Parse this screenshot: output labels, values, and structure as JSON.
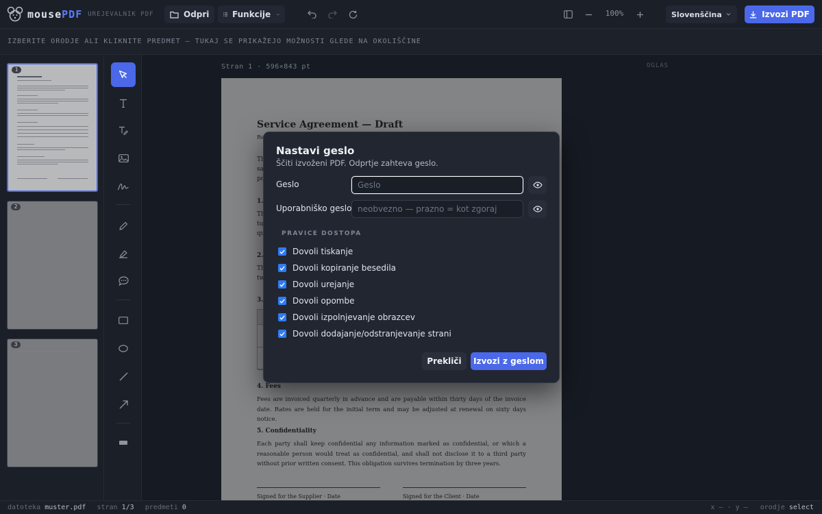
{
  "app": {
    "name_main": "mouse",
    "name_accent": "PDF",
    "subtitle": "UREJEVALNIK PDF"
  },
  "toolbar": {
    "open_label": "Odpri",
    "functions_label": "Funkcije",
    "zoom": "100%",
    "language": "Slovenščina",
    "export_label": "Izvozi PDF"
  },
  "context_hint": "IZBERITE ORODJE ALI KLIKNITE PREDMET — TUKAJ SE PRIKAŽEJO MOŽNOSTI GLEDE NA OKOLIŠČINE",
  "thumbnails": [
    {
      "num": "1"
    },
    {
      "num": "2"
    },
    {
      "num": "3"
    }
  ],
  "workspace": {
    "page_label": "Stran 1 · 596×843 pt",
    "ad_label": "OGLAS"
  },
  "document": {
    "title": "Service Agreement — Draft",
    "frag_ref": "Re",
    "frag_intro": [
      "Th",
      "sa",
      "po"
    ],
    "frag_h1": "1.",
    "frag_p1": [
      "Th",
      "tu",
      "qu"
    ],
    "frag_h2": "2.",
    "frag_p2": [
      "Th",
      "tw"
    ],
    "frag_h3": "3.",
    "h4": "4. Fees",
    "p4": "Fees are invoiced quarterly in advance and are payable within thirty days of the invoice date. Rates are held for the initial term and may be adjusted at renewal on sixty days notice.",
    "h5": "5. Confidentiality",
    "p5": "Each party shall keep confidential any information marked as confidential, or which a reasonable person would treat as confidential, and shall not disclose it to a third party without prior written consent. This obligation survives termination by three years.",
    "sig_supplier": "Signed for the Supplier · Date",
    "sig_client": "Signed for the Client · Date"
  },
  "modal": {
    "title": "Nastavi geslo",
    "subtitle": "Ščiti izvoženi PDF. Odprtje zahteva geslo.",
    "password_label": "Geslo",
    "password_value": "",
    "password_placeholder": "Geslo",
    "user_password_label": "Uporabniško geslo",
    "user_password_value": "",
    "user_password_placeholder": "neobvezno — prazno = kot zgoraj",
    "permissions_title": "PRAVICE DOSTOPA",
    "permissions": [
      {
        "label": "Dovoli tiskanje",
        "checked": true
      },
      {
        "label": "Dovoli kopiranje besedila",
        "checked": true
      },
      {
        "label": "Dovoli urejanje",
        "checked": true
      },
      {
        "label": "Dovoli opombe",
        "checked": true
      },
      {
        "label": "Dovoli izpolnjevanje obrazcev",
        "checked": true
      },
      {
        "label": "Dovoli dodajanje/odstranjevanje strani",
        "checked": true
      }
    ],
    "cancel_label": "Prekliči",
    "confirm_label": "Izvozi z geslom"
  },
  "status": {
    "file_key": "datoteka",
    "file_value": "muster.pdf",
    "page_key": "stran",
    "page_value": "1/3",
    "objects_key": "predmeti",
    "objects_value": "0",
    "coords": "x — · y —",
    "mode_key": "orodje",
    "mode_value": "select"
  },
  "colors": {
    "accent": "#4a68e8",
    "checkbox": "#2f7bf5",
    "background": "#161a22"
  },
  "icons": {
    "open": "folder-icon",
    "functions": "list-icon",
    "undo": "undo-icon",
    "redo": "redo-icon",
    "reload": "reload-icon",
    "panel": "panel-icon",
    "zoom_out": "minus-icon",
    "zoom_in": "plus-icon",
    "export": "download-icon",
    "password_toggle": "eye-icon"
  }
}
